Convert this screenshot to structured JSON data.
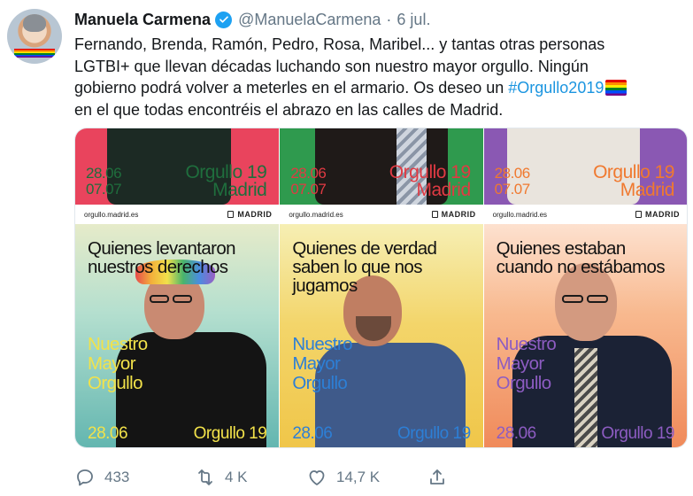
{
  "tweet": {
    "author_name": "Manuela Carmena",
    "handle": "@ManuelaCarmena",
    "separator": "·",
    "date": "6 jul.",
    "text_lines": [
      "Fernando, Brenda, Ramón, Pedro, Rosa, Maribel... y tantas otras personas",
      "LGTBI+ que llevan décadas luchando son nuestro mayor orgullo. Ningún",
      "gobierno podrá volver a meterles en el armario. Os deseo un "
    ],
    "hashtag": "#Orgullo2019",
    "text_last_line": "en el que todas encontréis el abrazo en las calles de Madrid."
  },
  "posters": [
    {
      "top_color": "#e9445d",
      "bottom_gradient": "linear-gradient(180deg, #dfe6c8 0%, #a9dccf 40%, #5fb7b3 100%)",
      "date_top": "28.06",
      "date_bottom": "07.07",
      "event_title": "Orgullo 19",
      "event_city": "Madrid",
      "top_text_color": "#1f6e3d",
      "site": "orgullo.madrid.es",
      "city_logo": "MADRID",
      "headline": "Quienes levantaron nuestros derechos",
      "tag_1": "Nuestro",
      "tag_2": "Mayor",
      "tag_3": "Orgullo",
      "tag_color": "#f2e24a",
      "footer_date": "28.06",
      "footer_event": "Orgullo 19",
      "footer_color": "#f2e24a"
    },
    {
      "top_color": "#2f9a4e",
      "bottom_gradient": "linear-gradient(180deg, #f6efb4 0%, #f3d56a 45%, #f0c649 100%)",
      "date_top": "28.06",
      "date_bottom": "07.07",
      "event_title": "Orgullo 19",
      "event_city": "Madrid",
      "top_text_color": "#e03a43",
      "site": "orgullo.madrid.es",
      "city_logo": "MADRID",
      "headline": "Quienes de verdad saben lo que nos jugamos",
      "tag_1": "Nuestro",
      "tag_2": "Mayor",
      "tag_3": "Orgullo",
      "tag_color": "#2d7fd6",
      "footer_date": "28.06",
      "footer_event": "Orgullo 19",
      "footer_color": "#2d7fd6"
    },
    {
      "top_color": "#8a58b3",
      "bottom_gradient": "linear-gradient(180deg, #fde1cf 0%, #f8b98f 40%, #f08a5a 100%)",
      "date_top": "28.06",
      "date_bottom": "07.07",
      "event_title": "Orgullo 19",
      "event_city": "Madrid",
      "top_text_color": "#f0792f",
      "site": "orgullo.madrid.es",
      "city_logo": "MADRID",
      "headline": "Quienes estaban cuando no estábamos",
      "tag_1": "Nuestro",
      "tag_2": "Mayor",
      "tag_3": "Orgullo",
      "tag_color": "#8d5cc2",
      "footer_date": "28.06",
      "footer_event": "Orgullo 19",
      "footer_color": "#8d5cc2"
    }
  ],
  "actions": {
    "reply_count": "433",
    "retweet_count": "4 K",
    "like_count": "14,7 K"
  },
  "icons": {
    "reply": "reply-icon",
    "retweet": "retweet-icon",
    "like": "heart-icon",
    "share": "share-icon",
    "verified": "verified-badge-icon"
  },
  "colors": {
    "link": "#1b95e0",
    "verified": "#1da1f2",
    "muted": "#657786"
  }
}
